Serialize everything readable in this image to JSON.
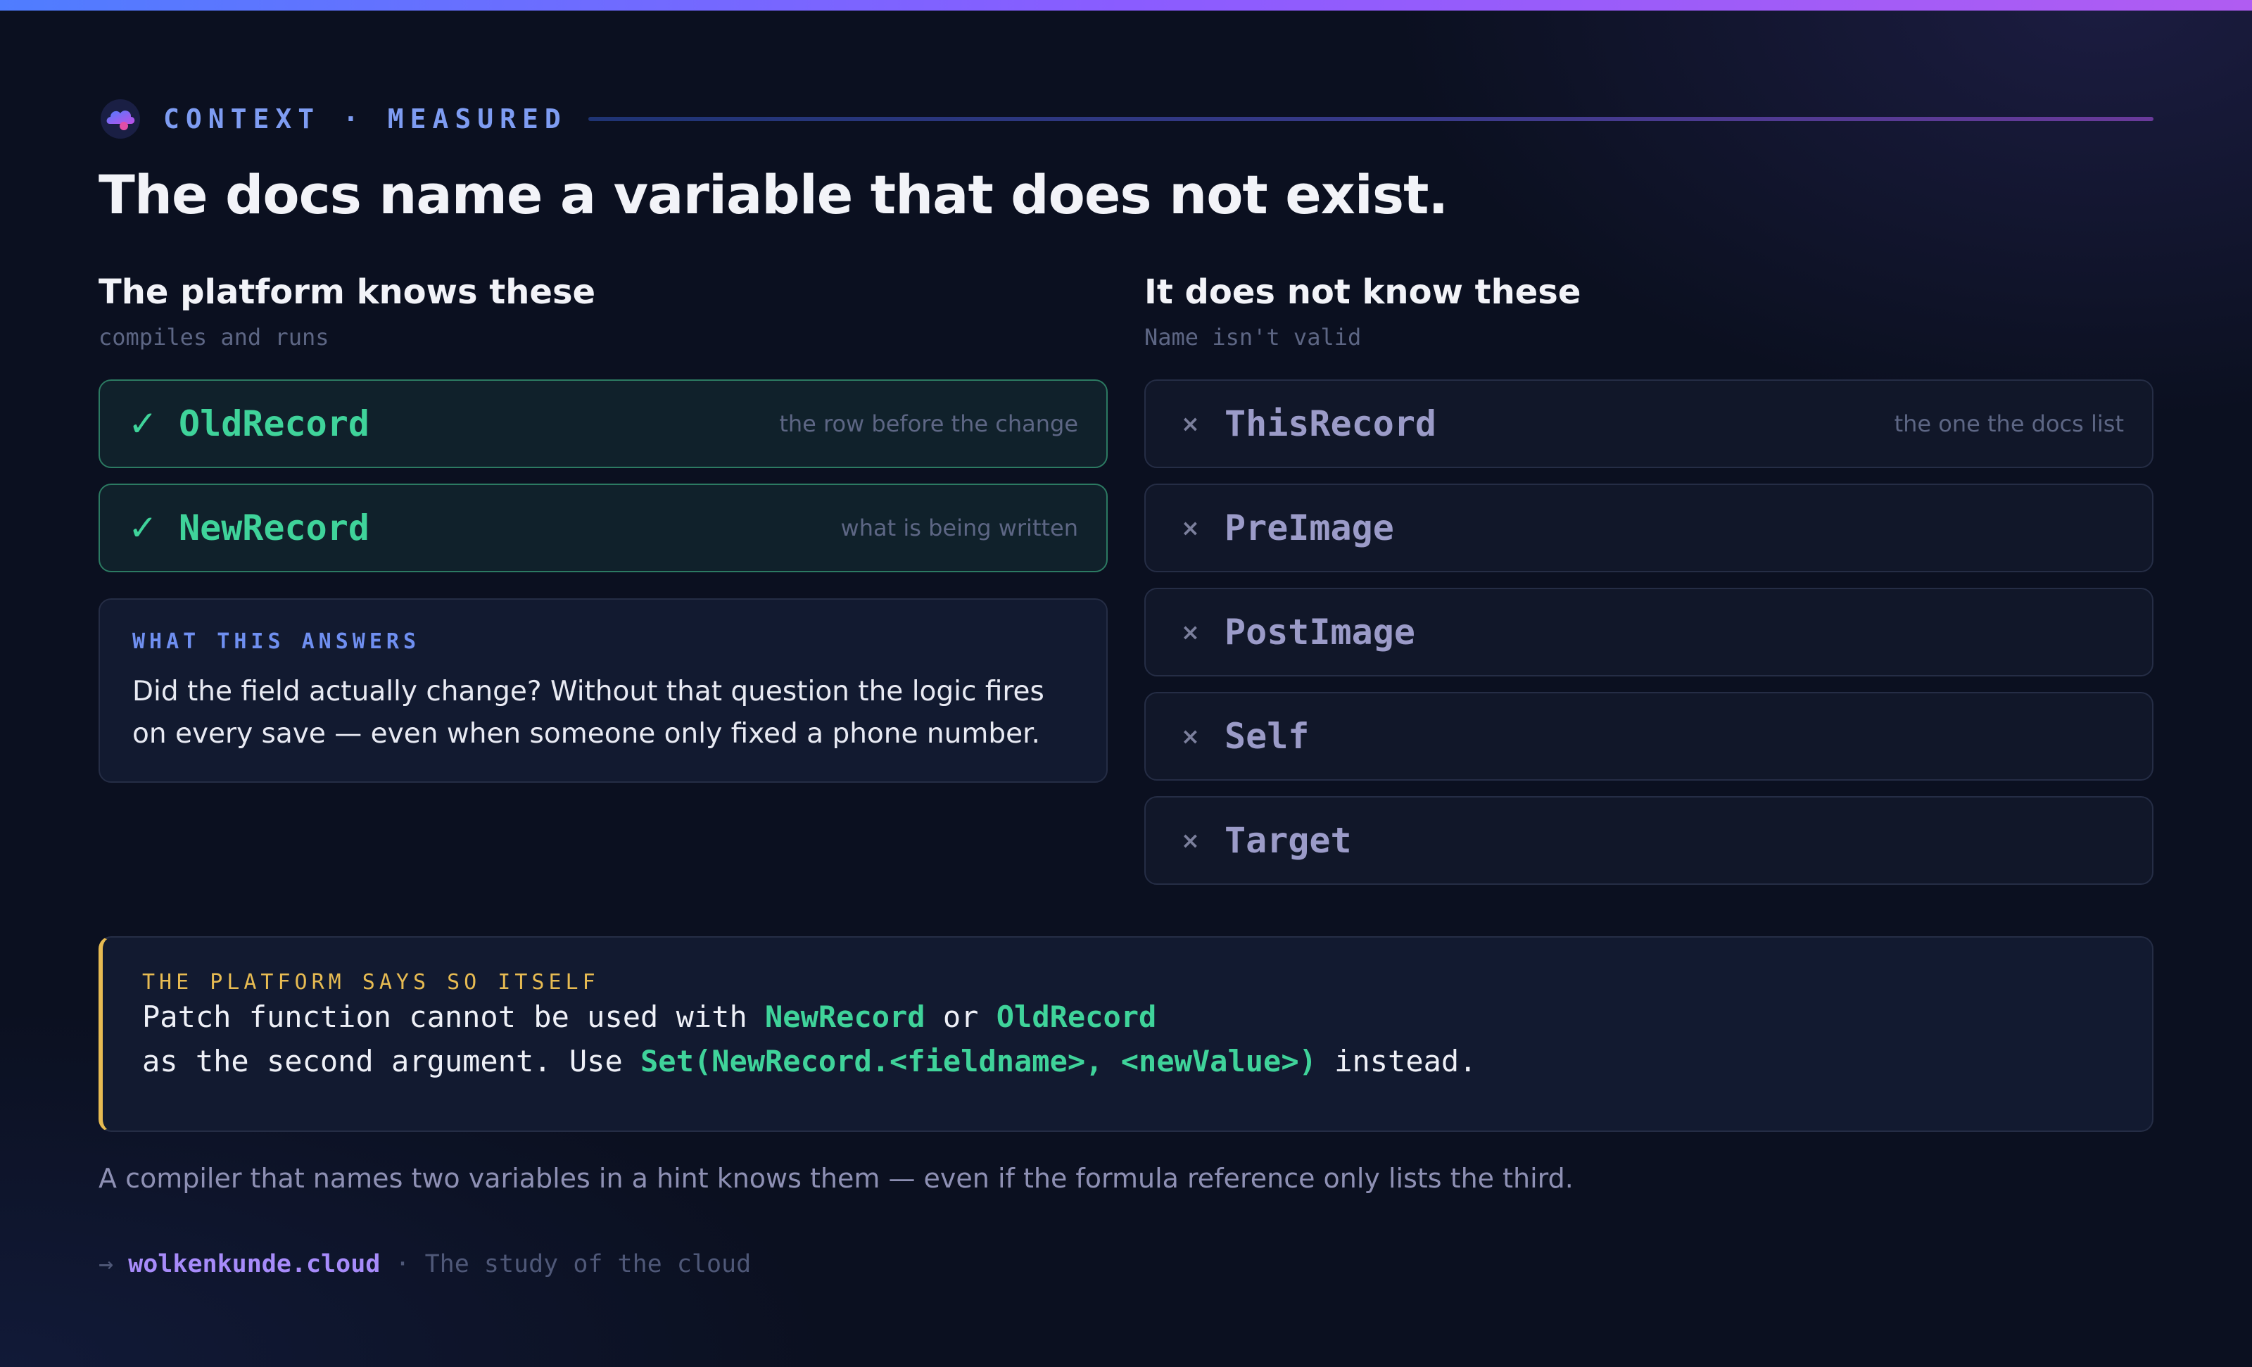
{
  "eyebrow": {
    "text": "CONTEXT · MEASURED"
  },
  "headline": "The docs name a variable that does not exist.",
  "known": {
    "title": "The platform knows these",
    "subtitle": "compiles and runs",
    "mark": "✓",
    "items": [
      {
        "name": "OldRecord",
        "note": "the row before the change"
      },
      {
        "name": "NewRecord",
        "note": "what is being written"
      }
    ]
  },
  "answers": {
    "label": "WHAT THIS ANSWERS",
    "text": "Did the field actually change? Without that question the logic fires on every save — even when someone only fixed a phone number."
  },
  "unknown": {
    "title": "It does not know these",
    "subtitle": "Name isn't valid",
    "mark": "×",
    "items": [
      {
        "name": "ThisRecord",
        "note": "the one the docs list"
      },
      {
        "name": "PreImage",
        "note": ""
      },
      {
        "name": "PostImage",
        "note": ""
      },
      {
        "name": "Self",
        "note": ""
      },
      {
        "name": "Target",
        "note": ""
      }
    ]
  },
  "platform": {
    "label": "THE PLATFORM SAYS SO ITSELF",
    "line1": [
      "Patch function cannot be used with ",
      "NewRecord",
      " or ",
      "OldRecord"
    ],
    "line2": [
      "as the second argument. Use ",
      "Set(NewRecord.<fieldname>, <newValue>)",
      " instead."
    ]
  },
  "footnote": "A compiler that names two variables in a hint knows them — even if the formula reference only lists the third.",
  "footer": {
    "arrow": "→",
    "brand": "wolkenkunde.cloud",
    "tagline": " · The study of the cloud"
  },
  "colors": {
    "accent_blue": "#7e9cf2",
    "ok_green": "#3fd39a",
    "warn_yellow": "#e7bb52",
    "brand_purple": "#a78bfa"
  },
  "icons": {
    "logo": "cloud-logo-icon",
    "ok": "check-icon",
    "no": "cross-icon"
  }
}
